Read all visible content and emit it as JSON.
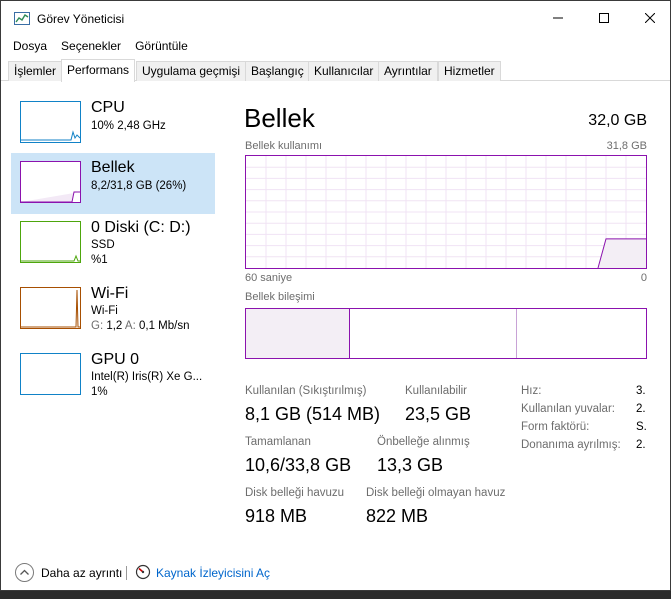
{
  "window": {
    "title": "Görev Yöneticisi"
  },
  "menu": [
    "Dosya",
    "Seçenekler",
    "Görüntüle"
  ],
  "tabs": [
    {
      "label": "İşlemler",
      "active": false
    },
    {
      "label": "Performans",
      "active": true
    },
    {
      "label": "Uygulama geçmişi",
      "active": false
    },
    {
      "label": "Başlangıç",
      "active": false
    },
    {
      "label": "Kullanıcılar",
      "active": false
    },
    {
      "label": "Ayrıntılar",
      "active": false
    },
    {
      "label": "Hizmetler",
      "active": false
    }
  ],
  "resources": [
    {
      "title": "CPU",
      "line1": "10% 2,48 GHz",
      "color": "#1182c7"
    },
    {
      "title": "Bellek",
      "line1": "8,2/31,8 GB (26%)",
      "color": "#8b12ae",
      "selected": true
    },
    {
      "title": "0 Diski (C: D:)",
      "line1": "SSD",
      "line2": "%1",
      "color": "#4da60c"
    },
    {
      "title": "Wi-Fi",
      "line1": "Wi-Fi",
      "line2_a": "G:",
      "line2_b": "1,2",
      "line2_c": "A:",
      "line2_d": "0,1 Mb/sn",
      "color": "#a74f01"
    },
    {
      "title": "GPU 0",
      "line1": "Intel(R) Iris(R) Xe G...",
      "line2": "1%",
      "color": "#1182c7"
    }
  ],
  "detail": {
    "title": "Bellek",
    "total": "32,0 GB",
    "usage_label": "Bellek kullanımı",
    "usage_max": "31,8 GB",
    "time_label": "60 saniye",
    "time_min": "0",
    "composition_label": "Bellek bileşimi",
    "usage_level": 0.26,
    "stats": {
      "in_use_label": "Kullanılan (Sıkıştırılmış)",
      "in_use_value": "8,1 GB (514 MB)",
      "available_label": "Kullanılabilir",
      "available_value": "23,5 GB",
      "committed_label": "Tamamlanan",
      "committed_value": "10,6/33,8 GB",
      "cached_label": "Önbelleğe alınmış",
      "cached_value": "13,3 GB",
      "paged_label": "Disk belleği havuzu",
      "paged_value": "918 MB",
      "nonpaged_label": "Disk belleği olmayan havuz",
      "nonpaged_value": "822 MB"
    },
    "side": [
      {
        "label": "Hız:",
        "value": "3."
      },
      {
        "label": "Kullanılan yuvalar:",
        "value": "2."
      },
      {
        "label": "Form faktörü:",
        "value": "S."
      },
      {
        "label": "Donanıma ayrılmış:",
        "value": "2."
      }
    ]
  },
  "footer": {
    "fewer_details": "Daha az ayrıntı",
    "open_monitor": "Kaynak İzleyicisini Aç"
  },
  "accent": "#8b12ae"
}
